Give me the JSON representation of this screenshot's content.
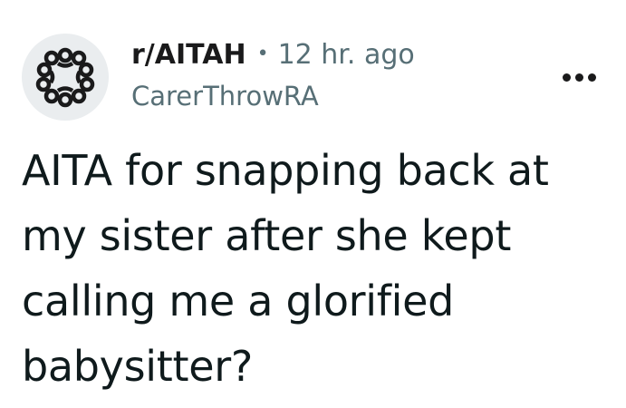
{
  "post": {
    "subreddit": "r/AITAH",
    "separator": "•",
    "time_ago": "12 hr. ago",
    "username": "CarerThrowRA",
    "title": "AITA for snapping back at my sister after she kept calling me a glorified babysitter?"
  },
  "icons": {
    "subreddit_avatar": "subreddit-community-icon",
    "overflow_menu": "more-options-icon"
  },
  "colors": {
    "avatar_background": "#eaedef",
    "meta_text": "#576f76",
    "primary_text": "#1a1a1b"
  }
}
